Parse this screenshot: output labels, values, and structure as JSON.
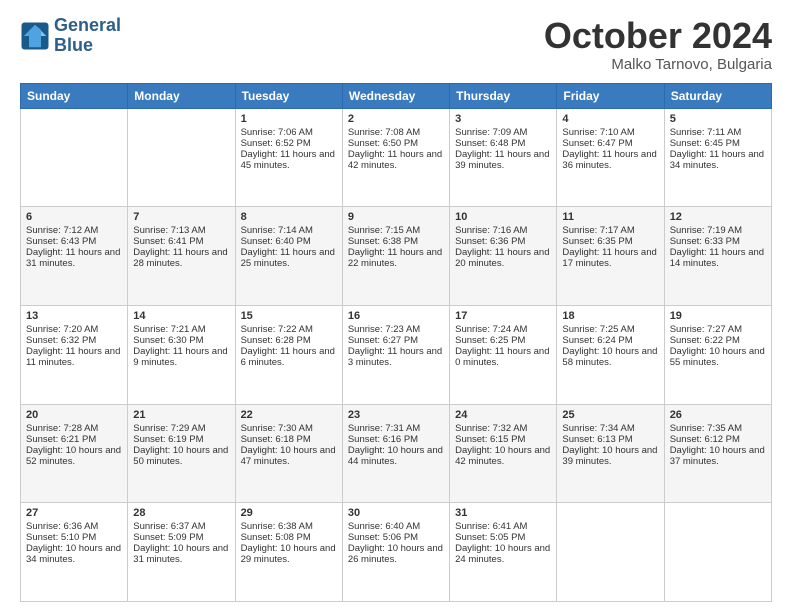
{
  "header": {
    "logo_line1": "General",
    "logo_line2": "Blue",
    "month": "October 2024",
    "location": "Malko Tarnovo, Bulgaria"
  },
  "days_of_week": [
    "Sunday",
    "Monday",
    "Tuesday",
    "Wednesday",
    "Thursday",
    "Friday",
    "Saturday"
  ],
  "weeks": [
    [
      {
        "day": "",
        "info": ""
      },
      {
        "day": "",
        "info": ""
      },
      {
        "day": "1",
        "info": "Sunrise: 7:06 AM\nSunset: 6:52 PM\nDaylight: 11 hours and 45 minutes."
      },
      {
        "day": "2",
        "info": "Sunrise: 7:08 AM\nSunset: 6:50 PM\nDaylight: 11 hours and 42 minutes."
      },
      {
        "day": "3",
        "info": "Sunrise: 7:09 AM\nSunset: 6:48 PM\nDaylight: 11 hours and 39 minutes."
      },
      {
        "day": "4",
        "info": "Sunrise: 7:10 AM\nSunset: 6:47 PM\nDaylight: 11 hours and 36 minutes."
      },
      {
        "day": "5",
        "info": "Sunrise: 7:11 AM\nSunset: 6:45 PM\nDaylight: 11 hours and 34 minutes."
      }
    ],
    [
      {
        "day": "6",
        "info": "Sunrise: 7:12 AM\nSunset: 6:43 PM\nDaylight: 11 hours and 31 minutes."
      },
      {
        "day": "7",
        "info": "Sunrise: 7:13 AM\nSunset: 6:41 PM\nDaylight: 11 hours and 28 minutes."
      },
      {
        "day": "8",
        "info": "Sunrise: 7:14 AM\nSunset: 6:40 PM\nDaylight: 11 hours and 25 minutes."
      },
      {
        "day": "9",
        "info": "Sunrise: 7:15 AM\nSunset: 6:38 PM\nDaylight: 11 hours and 22 minutes."
      },
      {
        "day": "10",
        "info": "Sunrise: 7:16 AM\nSunset: 6:36 PM\nDaylight: 11 hours and 20 minutes."
      },
      {
        "day": "11",
        "info": "Sunrise: 7:17 AM\nSunset: 6:35 PM\nDaylight: 11 hours and 17 minutes."
      },
      {
        "day": "12",
        "info": "Sunrise: 7:19 AM\nSunset: 6:33 PM\nDaylight: 11 hours and 14 minutes."
      }
    ],
    [
      {
        "day": "13",
        "info": "Sunrise: 7:20 AM\nSunset: 6:32 PM\nDaylight: 11 hours and 11 minutes."
      },
      {
        "day": "14",
        "info": "Sunrise: 7:21 AM\nSunset: 6:30 PM\nDaylight: 11 hours and 9 minutes."
      },
      {
        "day": "15",
        "info": "Sunrise: 7:22 AM\nSunset: 6:28 PM\nDaylight: 11 hours and 6 minutes."
      },
      {
        "day": "16",
        "info": "Sunrise: 7:23 AM\nSunset: 6:27 PM\nDaylight: 11 hours and 3 minutes."
      },
      {
        "day": "17",
        "info": "Sunrise: 7:24 AM\nSunset: 6:25 PM\nDaylight: 11 hours and 0 minutes."
      },
      {
        "day": "18",
        "info": "Sunrise: 7:25 AM\nSunset: 6:24 PM\nDaylight: 10 hours and 58 minutes."
      },
      {
        "day": "19",
        "info": "Sunrise: 7:27 AM\nSunset: 6:22 PM\nDaylight: 10 hours and 55 minutes."
      }
    ],
    [
      {
        "day": "20",
        "info": "Sunrise: 7:28 AM\nSunset: 6:21 PM\nDaylight: 10 hours and 52 minutes."
      },
      {
        "day": "21",
        "info": "Sunrise: 7:29 AM\nSunset: 6:19 PM\nDaylight: 10 hours and 50 minutes."
      },
      {
        "day": "22",
        "info": "Sunrise: 7:30 AM\nSunset: 6:18 PM\nDaylight: 10 hours and 47 minutes."
      },
      {
        "day": "23",
        "info": "Sunrise: 7:31 AM\nSunset: 6:16 PM\nDaylight: 10 hours and 44 minutes."
      },
      {
        "day": "24",
        "info": "Sunrise: 7:32 AM\nSunset: 6:15 PM\nDaylight: 10 hours and 42 minutes."
      },
      {
        "day": "25",
        "info": "Sunrise: 7:34 AM\nSunset: 6:13 PM\nDaylight: 10 hours and 39 minutes."
      },
      {
        "day": "26",
        "info": "Sunrise: 7:35 AM\nSunset: 6:12 PM\nDaylight: 10 hours and 37 minutes."
      }
    ],
    [
      {
        "day": "27",
        "info": "Sunrise: 6:36 AM\nSunset: 5:10 PM\nDaylight: 10 hours and 34 minutes."
      },
      {
        "day": "28",
        "info": "Sunrise: 6:37 AM\nSunset: 5:09 PM\nDaylight: 10 hours and 31 minutes."
      },
      {
        "day": "29",
        "info": "Sunrise: 6:38 AM\nSunset: 5:08 PM\nDaylight: 10 hours and 29 minutes."
      },
      {
        "day": "30",
        "info": "Sunrise: 6:40 AM\nSunset: 5:06 PM\nDaylight: 10 hours and 26 minutes."
      },
      {
        "day": "31",
        "info": "Sunrise: 6:41 AM\nSunset: 5:05 PM\nDaylight: 10 hours and 24 minutes."
      },
      {
        "day": "",
        "info": ""
      },
      {
        "day": "",
        "info": ""
      }
    ]
  ]
}
